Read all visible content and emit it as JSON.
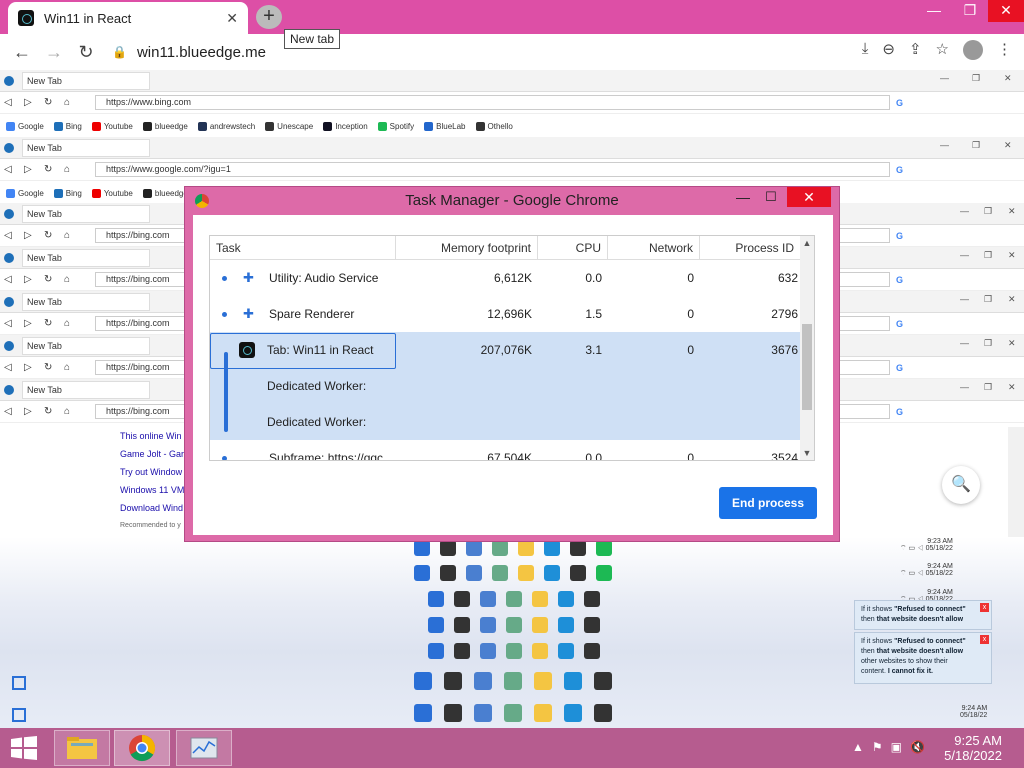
{
  "browser": {
    "tab_title": "Win11 in React",
    "tab_close": "✕",
    "new_tab_tooltip": "New tab",
    "url": "win11.blueedge.me",
    "window_controls": {
      "minimize": "—",
      "restore": "❐",
      "close": "✕"
    }
  },
  "nested": [
    {
      "tab": "New Tab",
      "url": "https://www.bing.com",
      "bookmarks": true
    },
    {
      "tab": "New Tab",
      "url": "https://www.google.com/?igu=1",
      "bookmarks": true
    },
    {
      "tab": "New Tab",
      "url": "https://bing.com",
      "bookmarks": false
    },
    {
      "tab": "New Tab",
      "url": "https://bing.com",
      "bookmarks": false
    },
    {
      "tab": "New Tab",
      "url": "https://bing.com",
      "bookmarks": false
    },
    {
      "tab": "New Tab",
      "url": "https://bing.com",
      "bookmarks": false
    },
    {
      "tab": "New Tab",
      "url": "https://bing.com",
      "bookmarks": false
    }
  ],
  "bookmarks": [
    "Google",
    "Bing",
    "Youtube",
    "blueedge",
    "andrewstech",
    "Unescape",
    "Inception",
    "Spotify",
    "BlueLab",
    "Othello"
  ],
  "bookmark_colors": [
    "#4285f4",
    "#1e6fb8",
    "#e00",
    "#222",
    "#235",
    "#333",
    "#112",
    "#1db954",
    "#2266cc",
    "#333"
  ],
  "page_links": [
    "This online Win",
    "Game Jolt - Gar",
    "Try out Window",
    "Windows 11 VM",
    "Download Wind"
  ],
  "page_links_footer": "Recommended to y",
  "task_manager": {
    "title": "Task Manager - Google Chrome",
    "columns": [
      "Task",
      "Memory footprint",
      "CPU",
      "Network",
      "Process ID"
    ],
    "rows": [
      {
        "task": "Utility: Audio Service",
        "memory": "6,612K",
        "cpu": "0.0",
        "network": "0",
        "pid": "632",
        "icon": "puzzle-icon"
      },
      {
        "task": "Spare Renderer",
        "memory": "12,696K",
        "cpu": "1.5",
        "network": "0",
        "pid": "2796",
        "icon": "puzzle-icon"
      },
      {
        "task": "Tab: Win11 in React",
        "memory": "207,076K",
        "cpu": "3.1",
        "network": "0",
        "pid": "3676",
        "icon": "tab-favicon-icon"
      },
      {
        "task": "Dedicated Worker:",
        "memory": "",
        "cpu": "",
        "network": "",
        "pid": "",
        "icon": ""
      },
      {
        "task": "Dedicated Worker:",
        "memory": "",
        "cpu": "",
        "network": "",
        "pid": "",
        "icon": ""
      },
      {
        "task": "Subframe: https://qqc...",
        "memory": "67,504K",
        "cpu": "0.0",
        "network": "0",
        "pid": "3524",
        "icon": ""
      }
    ],
    "end_process": "End process"
  },
  "tray": {
    "times": [
      "9:23 AM",
      "9:24 AM",
      "9:24 AM",
      "9:24 AM"
    ],
    "dates": [
      "05/18/22",
      "05/18/22",
      "05/18/22",
      "05/18/22"
    ],
    "last_time": "9:24 AM",
    "last_date": "05/18/22"
  },
  "notification": {
    "line1_pre": "If it shows ",
    "line1_bold": "\"Refused to connect\"",
    "line2_pre": "then ",
    "line2_bold": "that website doesn't allow",
    "line3": "other websites to show their",
    "line4_pre": "content. ",
    "line4_bold": "I cannot fix it.",
    "close": "x"
  },
  "taskbar": {
    "time": "9:25 AM",
    "date": "5/18/2022"
  }
}
